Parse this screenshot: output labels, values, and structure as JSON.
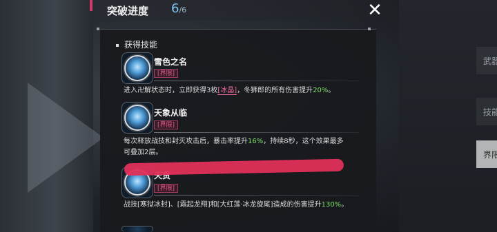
{
  "header": {
    "title": "突破进度",
    "progress_current": "6",
    "progress_total": "/6",
    "close_glyph": "✕"
  },
  "right_tabs": [
    {
      "label": "武器"
    },
    {
      "label": "技能"
    },
    {
      "label": "界限"
    }
  ],
  "section": {
    "heading": "获得技能"
  },
  "skills": [
    {
      "name": "雪色之名",
      "badge": "[界限]",
      "desc_1": "进入卍解状态时，立即获得3枚",
      "desc_hl": "[冰晶]",
      "desc_2": "，冬狮郎的所有伤害提升",
      "desc_pct": "20%",
      "desc_3": "。",
      "icon": "ice-dragon-icon"
    },
    {
      "name": "天象从临",
      "badge": "[界限]",
      "desc_1": "每次释放战技和封灭攻击后，暴击率提升",
      "desc_pct": "16%",
      "desc_2": "，持续8秒，这个效果最多",
      "desc_line2": "可叠加2层。",
      "icon": "ice-vortex-icon"
    },
    {
      "name": "天贯",
      "badge": "[界限]",
      "desc_1": "战技[寒狱冰封]、[霜起龙翔]和[大红莲·冰龙旋尾]造成的伤害提升",
      "desc_pct": "130%",
      "desc_2": "。",
      "icon": "ice-pillar-icon"
    }
  ],
  "colors": {
    "accent_pink": "#f06b9c",
    "highlight_green": "#7fe06a",
    "progress_blue": "#7fc4f0",
    "scribble_red": "#e0305a"
  }
}
